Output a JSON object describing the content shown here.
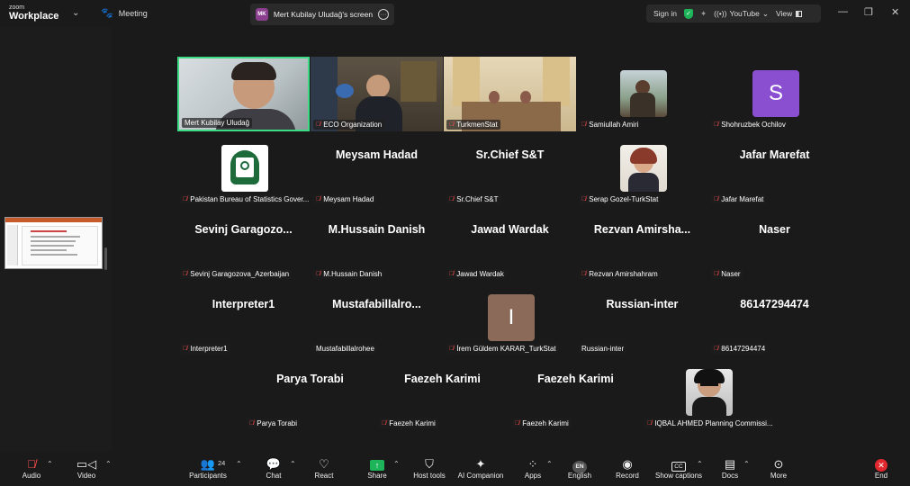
{
  "titlebar": {
    "brand_small": "zoom",
    "brand_big": "Workplace",
    "meeting_label": "Meeting",
    "screen_initials": "MK",
    "screen_label": "Mert Kubilay Uludağ's screen",
    "signin": "Sign in",
    "youtube": "YouTube",
    "view": "View"
  },
  "tiles": [
    {
      "name": "Mert Kubilay Uludağ"
    },
    {
      "name": "ECO Organization"
    },
    {
      "name": "TurkmenStat"
    },
    {
      "name": "Samiullah Amiri"
    },
    {
      "name": "Shohruzbek Ochilov",
      "letter": "S"
    },
    {
      "name": "Pakistan Bureau of Statistics Gover..."
    },
    {
      "name": "Meysam Hadad",
      "big": "Meysam Hadad"
    },
    {
      "name": "Sr.Chief S&T",
      "big": "Sr.Chief S&T"
    },
    {
      "name": "Serap Gozel-TurkStat"
    },
    {
      "name": "Jafar Marefat",
      "big": "Jafar Marefat"
    },
    {
      "name": "Sevinj Garagozova_Azerbaijan",
      "big": "Sevinj  Garagozo..."
    },
    {
      "name": "M.Hussain Danish",
      "big": "M.Hussain Danish"
    },
    {
      "name": "Jawad Wardak",
      "big": "Jawad Wardak"
    },
    {
      "name": "Rezvan Amirshahram",
      "big": "Rezvan  Amirsha..."
    },
    {
      "name": "Naser",
      "big": "Naser"
    },
    {
      "name": "Interpreter1",
      "big": "Interpreter1"
    },
    {
      "name": "Mustafabillalrohee",
      "big": "Mustafabillalro..."
    },
    {
      "name": "İrem Güldem KARAR_TurkStat",
      "letter": "I"
    },
    {
      "name": "Russian-inter",
      "big": "Russian-inter"
    },
    {
      "name": "86147294474",
      "big": "86147294474"
    },
    {
      "name": "Parya Torabi",
      "big": "Parya Torabi"
    },
    {
      "name": "Faezeh Karimi",
      "big": "Faezeh Karimi"
    },
    {
      "name": "Faezeh Karimi",
      "big": "Faezeh Karimi"
    },
    {
      "name": "IQBAL AHMED Planning Commissi..."
    }
  ],
  "toolbar": {
    "audio": "Audio",
    "video": "Video",
    "participants": "Participants",
    "participants_count": "24",
    "chat": "Chat",
    "react": "React",
    "share": "Share",
    "host_tools": "Host tools",
    "ai_companion": "AI Companion",
    "apps": "Apps",
    "language_code": "EN",
    "english": "English",
    "record": "Record",
    "show_captions": "Show captions",
    "cc": "CC",
    "docs": "Docs",
    "more": "More",
    "end": "End"
  },
  "colors": {
    "active_border": "#3ddc84",
    "share_green": "#1eb45a",
    "end_red": "#e0282e",
    "letter_s": "#8a4fd0",
    "letter_i": "#8b6a5a"
  }
}
